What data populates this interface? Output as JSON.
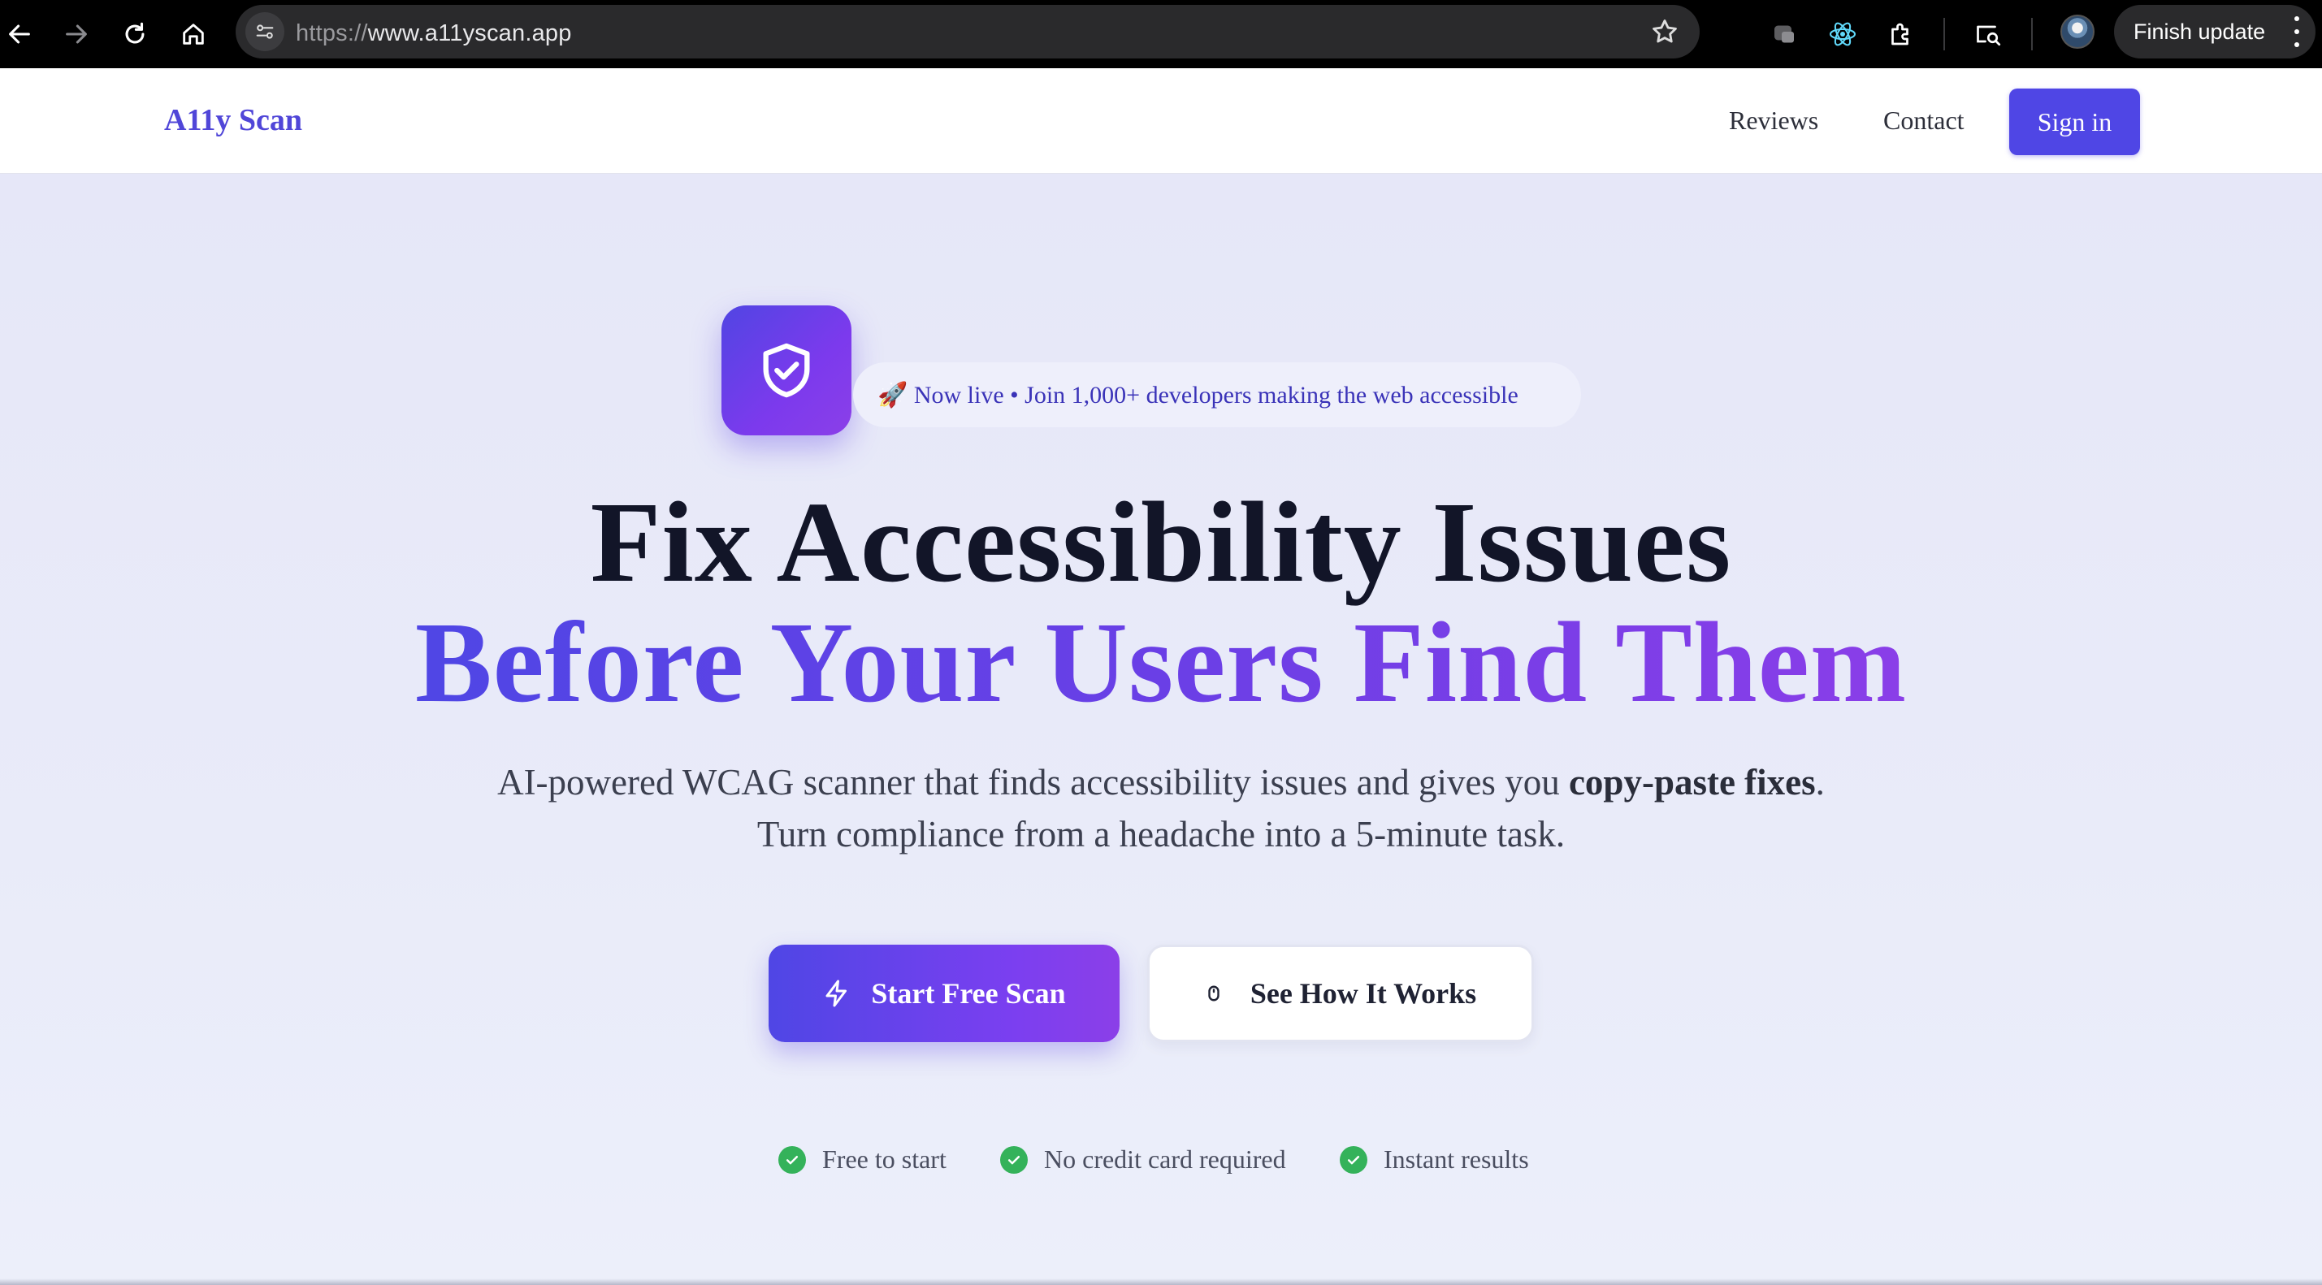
{
  "browser": {
    "url_scheme": "https://",
    "url_host": "www.a11yscan.app",
    "finish_update_label": "Finish update",
    "icons": [
      "back-icon",
      "forward-icon",
      "reload-icon",
      "home-icon",
      "site-settings-icon",
      "bookmark-star-icon",
      "extension-icon",
      "react-devtools-icon",
      "puzzle-extensions-icon",
      "lens-search-icon",
      "profile-avatar",
      "more-vert-icon"
    ]
  },
  "site": {
    "logo": "A11y Scan",
    "nav": {
      "reviews": "Reviews",
      "contact": "Contact",
      "sign_in": "Sign in"
    }
  },
  "hero": {
    "badge": "🚀 Now live • Join 1,000+ developers making the web accessible",
    "headline_line1": "Fix Accessibility Issues",
    "headline_line2": "Before Your Users Find Them",
    "subtitle_part1": "AI-powered WCAG scanner that finds accessibility issues and gives you ",
    "subtitle_bold": "copy-paste fixes",
    "subtitle_part2": ".",
    "subtitle_line2": "Turn compliance from a headache into a 5-minute task.",
    "primary_cta": "Start Free Scan",
    "secondary_cta": "See How It Works",
    "perks": [
      "Free to start",
      "No credit card required",
      "Instant results"
    ]
  },
  "colors": {
    "brand": "#4f46e5",
    "brand_purple": "#8b3fe8",
    "check_green": "#34b25a",
    "headline_dark": "#121528"
  }
}
